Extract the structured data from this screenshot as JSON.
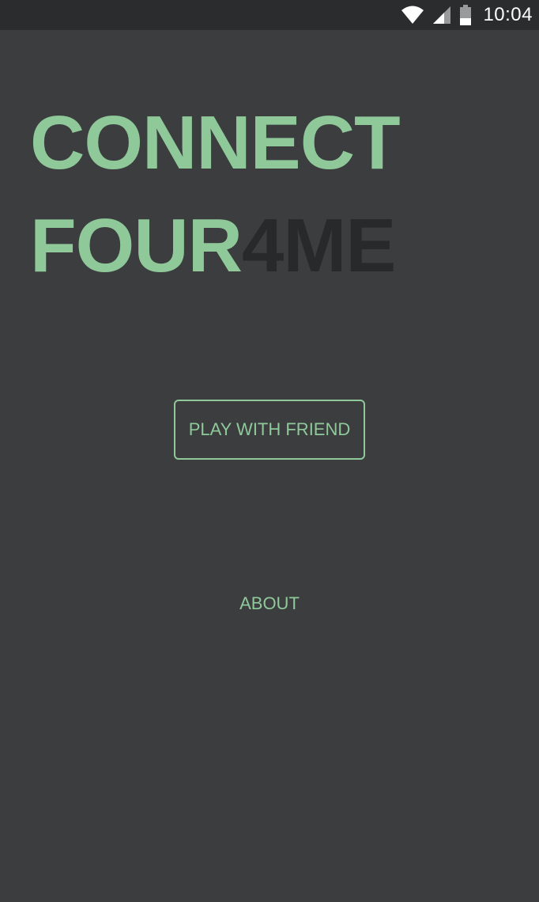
{
  "status_bar": {
    "time": "10:04",
    "icons": [
      "wifi-icon",
      "cell-signal-icon",
      "battery-icon"
    ]
  },
  "title": {
    "line1": "CONNECT",
    "line2_main": "FOUR",
    "line2_accent": "4ME"
  },
  "buttons": {
    "play_label": "PLAY WITH FRIEND",
    "about_label": "ABOUT"
  },
  "colors": {
    "background": "#3c3d3f",
    "status_bar": "#2b2c2e",
    "accent_green": "#8fc99a",
    "dark_text": "#28292b"
  }
}
